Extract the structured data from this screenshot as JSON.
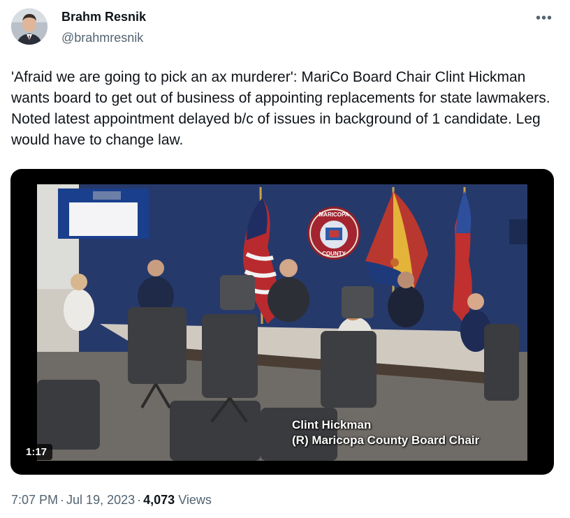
{
  "author": {
    "name": "Brahm Resnik",
    "handle": "@brahmresnik"
  },
  "tweet": {
    "text": "'Afraid we are going to pick an ax murderer': MariCo Board Chair Clint Hickman wants board to get out of business of appointing replacements for state lawmakers. Noted latest appointment delayed b/c of issues in background of 1 candidate. Leg would have to change law."
  },
  "media": {
    "caption_line1": "Clint Hickman",
    "caption_line2": "(R) Maricopa County Board Chair",
    "duration": "1:17",
    "seal_text_top": "MARICOPA",
    "seal_text_bottom": "COUNTY"
  },
  "meta": {
    "time": "7:07 PM",
    "separator": "·",
    "date": "Jul 19, 2023",
    "views_count": "4,073",
    "views_label": "Views"
  },
  "icons": {
    "more": "more-horizontal-icon"
  },
  "colors": {
    "text_primary": "#0f1419",
    "text_secondary": "#536471",
    "wall_blue": "#243b73"
  }
}
